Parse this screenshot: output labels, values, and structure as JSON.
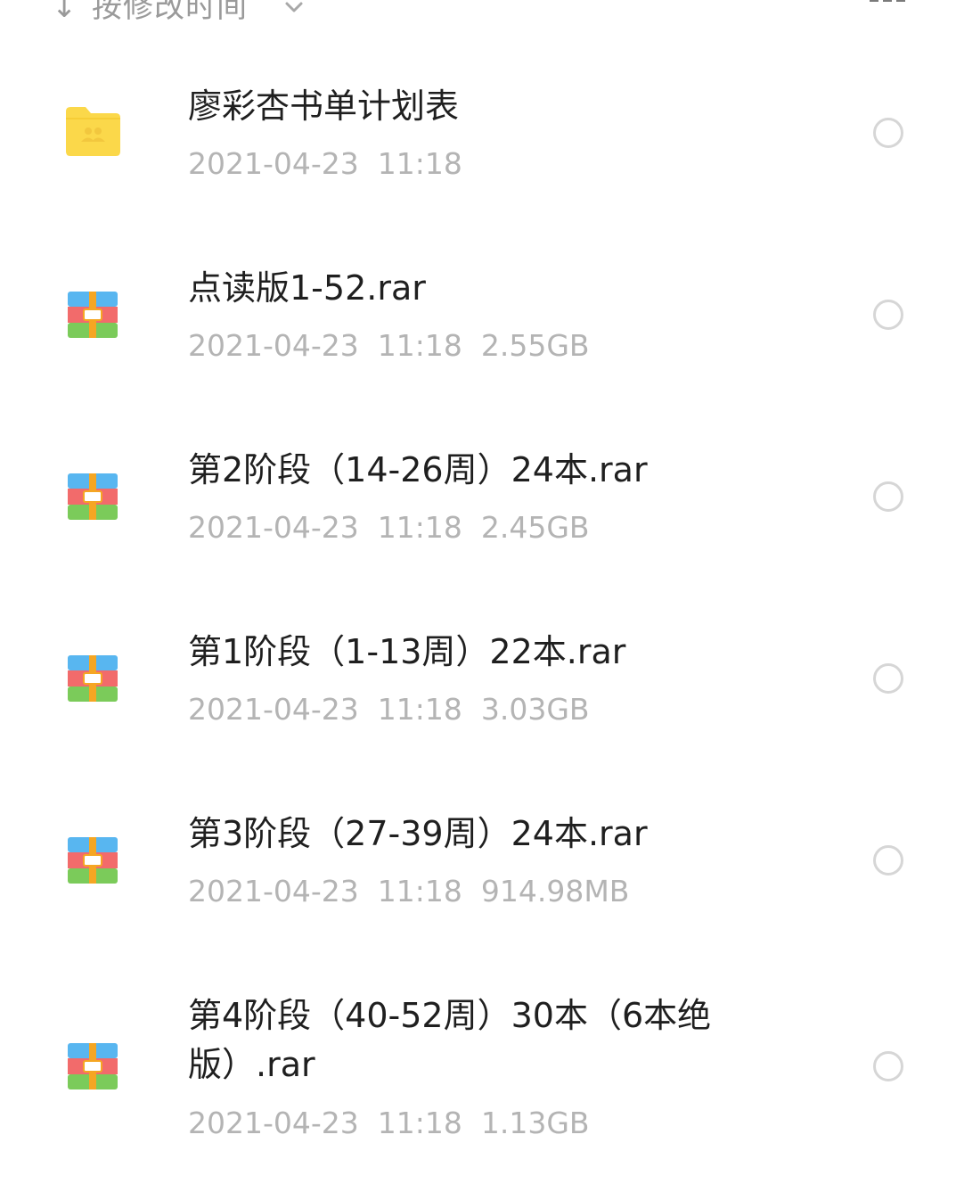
{
  "sort": {
    "label": "按修改时间",
    "arrow_icon": "sort-down-arrow-icon",
    "chevron_icon": "chevron-down-icon",
    "view_toggle_icon": "grid-view-icon"
  },
  "colors": {
    "folder": "#FBD84A",
    "archive_blue": "#58B6F0",
    "archive_red": "#F26B6B",
    "archive_green": "#7BCB5A",
    "archive_strap": "#F5A623",
    "meta_text": "#B4B4B4",
    "name_text": "#1F1F1F"
  },
  "files": [
    {
      "name": "廖彩杏书单计划表",
      "date": "2021-04-23",
      "time": "11:18",
      "size": "",
      "icon": "shared-folder-icon",
      "type": "folder"
    },
    {
      "name": "点读版1-52.rar",
      "date": "2021-04-23",
      "time": "11:18",
      "size": "2.55GB",
      "icon": "archive-icon",
      "type": "archive"
    },
    {
      "name": "第2阶段（14-26周）24本.rar",
      "date": "2021-04-23",
      "time": "11:18",
      "size": "2.45GB",
      "icon": "archive-icon",
      "type": "archive"
    },
    {
      "name": "第1阶段（1-13周）22本.rar",
      "date": "2021-04-23",
      "time": "11:18",
      "size": "3.03GB",
      "icon": "archive-icon",
      "type": "archive"
    },
    {
      "name": "第3阶段（27-39周）24本.rar",
      "date": "2021-04-23",
      "time": "11:18",
      "size": "914.98MB",
      "icon": "archive-icon",
      "type": "archive"
    },
    {
      "name": "第4阶段（40-52周）30本（6本绝版）.rar",
      "date": "2021-04-23",
      "time": "11:18",
      "size": "1.13GB",
      "icon": "archive-icon",
      "type": "archive"
    }
  ]
}
